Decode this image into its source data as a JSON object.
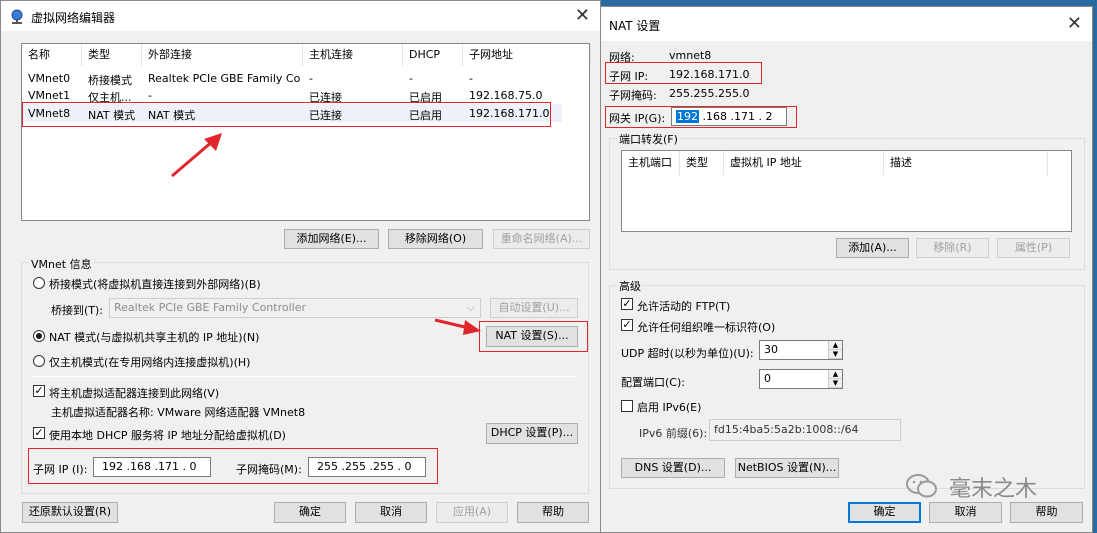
{
  "left_window": {
    "title": "虚拟网络编辑器",
    "columns": [
      "名称",
      "类型",
      "外部连接",
      "主机连接",
      "DHCP",
      "子网地址"
    ],
    "rows": [
      [
        "VMnet0",
        "桥接模式",
        "Realtek PCIe GBE Family Co...",
        "-",
        "-",
        "-"
      ],
      [
        "VMnet1",
        "仅主机...",
        "-",
        "已连接",
        "已启用",
        "192.168.75.0"
      ],
      [
        "VMnet8",
        "NAT 模式",
        "NAT 模式",
        "已连接",
        "已启用",
        "192.168.171.0"
      ]
    ],
    "add_network": "添加网络(E)...",
    "remove_network": "移除网络(O)",
    "rename_network": "重命名网络(A)...",
    "vmnet_info_label": "VMnet 信息",
    "bridge_mode": "桥接模式(将虚拟机直接连接到外部网络)(B)",
    "bridged_to_label": "桥接到(T):",
    "bridged_to_value": "Realtek PCIe GBE Family Controller",
    "auto_settings": "自动设置(U)...",
    "nat_mode": "NAT 模式(与虚拟机共享主机的 IP 地址)(N)",
    "nat_settings": "NAT 设置(S)...",
    "host_only_mode": "仅主机模式(在专用网络内连接虚拟机)(H)",
    "connect_adapter": "将主机虚拟适配器连接到此网络(V)",
    "adapter_name": "主机虚拟适配器名称: VMware 网络适配器 VMnet8",
    "use_dhcp": "使用本地 DHCP 服务将 IP 地址分配给虚拟机(D)",
    "dhcp_settings": "DHCP 设置(P)...",
    "subnet_ip_label": "子网 IP (I):",
    "subnet_ip_value": "192 .168 .171 . 0",
    "subnet_mask_label": "子网掩码(M):",
    "subnet_mask_value": "255 .255 .255 . 0",
    "restore_defaults": "还原默认设置(R)",
    "ok": "确定",
    "cancel": "取消",
    "apply": "应用(A)",
    "help": "帮助"
  },
  "right_window": {
    "title": "NAT 设置",
    "network_label": "网络:",
    "network_value": "vmnet8",
    "subnet_ip_label": "子网 IP:",
    "subnet_ip_value": "192.168.171.0",
    "subnet_mask_label": "子网掩码:",
    "subnet_mask_value": "255.255.255.0",
    "gateway_label": "网关 IP(G):",
    "gateway_first": "192",
    "gateway_rest": " .168 .171 . 2",
    "port_forward_label": "端口转发(F)",
    "pf_columns": [
      "主机端口",
      "类型",
      "虚拟机 IP 地址",
      "描述"
    ],
    "add": "添加(A)...",
    "remove": "移除(R)",
    "properties": "属性(P)",
    "advanced_label": "高级",
    "allow_ftp": "允许活动的 FTP(T)",
    "allow_uid": "允许任何组织唯一标识符(O)",
    "udp_timeout_label": "UDP 超时(以秒为单位)(U):",
    "udp_timeout_value": "30",
    "config_port_label": "配置端口(C):",
    "config_port_value": "0",
    "enable_ipv6": "启用 IPv6(E)",
    "ipv6_prefix_label": "IPv6 前缀(6):",
    "ipv6_prefix_value": "fd15:4ba5:5a2b:1008::/64",
    "dns_settings": "DNS 设置(D)...",
    "netbios_settings": "NetBIOS 设置(N)...",
    "ok": "确定",
    "cancel": "取消",
    "help": "帮助"
  },
  "watermark": "毫末之木"
}
